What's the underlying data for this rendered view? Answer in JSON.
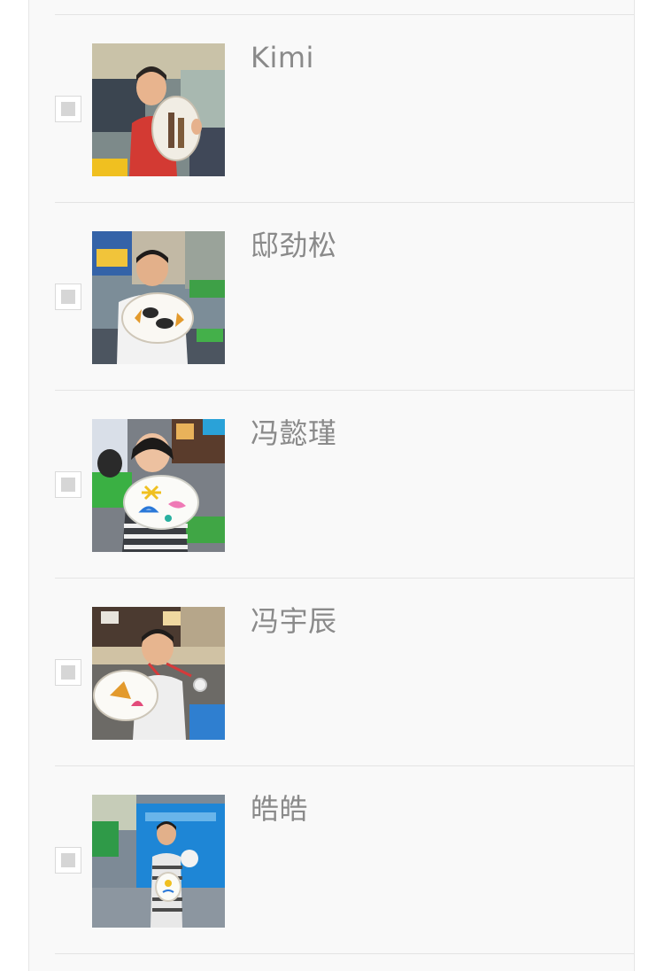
{
  "entries": [
    {
      "name": "Kimi",
      "photo_icon": "photo-boy-red-shirt",
      "checked": false
    },
    {
      "name": "邸劲松",
      "photo_icon": "photo-boy-white-shirt",
      "checked": false
    },
    {
      "name": "冯懿瑾",
      "photo_icon": "photo-girl-striped-shirt",
      "checked": false
    },
    {
      "name": "冯宇辰",
      "photo_icon": "photo-boy-medal",
      "checked": false
    },
    {
      "name": "皓皓",
      "photo_icon": "photo-boy-blue-backdrop",
      "checked": false
    }
  ],
  "colors": {
    "panel_background": "#f9f9f9",
    "divider": "#e4e4e4",
    "name_text": "#8a8a8a",
    "checkbox_fill": "#d6d6d6"
  }
}
